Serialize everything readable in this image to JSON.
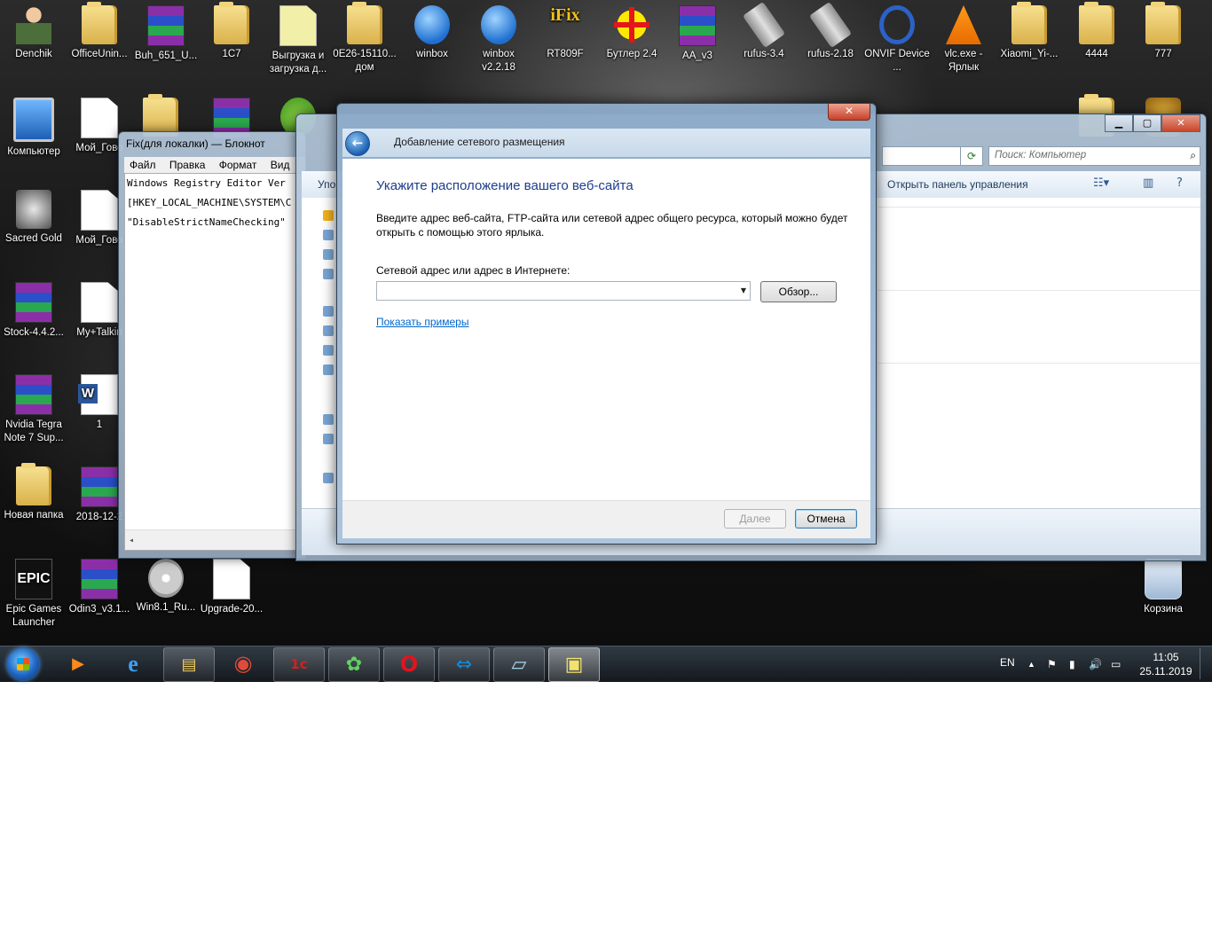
{
  "desktop": {
    "icons": [
      {
        "label": "Denchik",
        "icon": "user-folder-icon"
      },
      {
        "label": "OfficeUnin...",
        "icon": "folder-icon"
      },
      {
        "label": "Buh_651_U...",
        "icon": "winrar-icon"
      },
      {
        "label": "1C7",
        "icon": "folder-icon"
      },
      {
        "label": "Выгрузка и загрузка д...",
        "icon": "file-icon"
      },
      {
        "label": "0E26-15110... дом",
        "icon": "folder-icon"
      },
      {
        "label": "winbox",
        "icon": "winbox-icon"
      },
      {
        "label": "winbox v2.2.18",
        "icon": "winbox-icon"
      },
      {
        "label": "RT809F",
        "icon": "ifix-icon"
      },
      {
        "label": "Бутлер 2.4",
        "icon": "cross-icon"
      },
      {
        "label": "AA_v3",
        "icon": "winrar-icon"
      },
      {
        "label": "rufus-3.4",
        "icon": "usb-icon"
      },
      {
        "label": "rufus-2.18",
        "icon": "usb-icon"
      },
      {
        "label": "ONVIF Device ...",
        "icon": "onvif-icon"
      },
      {
        "label": "vlc.exe - Ярлык",
        "icon": "vlc-icon"
      },
      {
        "label": "Xiaomi_Yi-...",
        "icon": "folder-icon"
      },
      {
        "label": "4444",
        "icon": "folder-icon"
      },
      {
        "label": "777",
        "icon": "folder-icon"
      },
      {
        "label": "Компьютер",
        "icon": "computer-icon"
      },
      {
        "label": "Мой_Гово",
        "icon": "file-icon"
      },
      {
        "label": "Sacred Gold",
        "icon": "game-icon"
      },
      {
        "label": "Мой_Гово",
        "icon": "file-icon"
      },
      {
        "label": "Stock-4.4.2...",
        "icon": "winrar-icon"
      },
      {
        "label": "My+Talkin",
        "icon": "file-icon"
      },
      {
        "label": "Nvidia Tegra Note 7 Sup...",
        "icon": "winrar-icon"
      },
      {
        "label": "1",
        "icon": "word-icon"
      },
      {
        "label": "Новая папка",
        "icon": "folder-icon"
      },
      {
        "label": "2018-12-2",
        "icon": "winrar-icon"
      },
      {
        "label": "Epic Games Launcher",
        "icon": "epic-games-icon"
      },
      {
        "label": "Odin3_v3.1...",
        "icon": "winrar-icon"
      },
      {
        "label": "Win8.1_Ru...",
        "icon": "disc-image-icon"
      },
      {
        "label": "Upgrade-20...",
        "icon": "text-file-icon"
      },
      {
        "label": "Корзина",
        "icon": "recycle-bin-icon"
      }
    ],
    "epic_logo_text": "EPIC",
    "ifix_logo_text": "iFix"
  },
  "notepad": {
    "title": "Fix(для локалки) — Блокнот",
    "menu": [
      "Файл",
      "Правка",
      "Формат",
      "Вид"
    ],
    "lines": [
      "Windows Registry Editor Ver",
      "[HKEY_LOCAL_MACHINE\\SYSTEM\\C",
      "\"DisableStrictNameChecking\""
    ],
    "scroll_left_arrow": "◂"
  },
  "explorer": {
    "caption": {
      "minimize": "▁",
      "maximize": "▢",
      "close": "✕"
    },
    "search_placeholder": "Поиск: Компьютер",
    "toolbar_organize": "Упо",
    "toolbar_control_panel": "Открыть панель управления"
  },
  "dialog": {
    "title": "Добавление сетевого размещения",
    "close_glyph": "✕",
    "back_glyph": "←",
    "heading": "Укажите расположение вашего веб-сайта",
    "description": "Введите адрес веб-сайта, FTP-сайта или сетевой адрес общего ресурса, который можно будет открыть с помощью этого ярлыка.",
    "address_label": "Сетевой адрес или адрес в Интернете:",
    "address_value": "",
    "browse_button": "Обзор...",
    "examples_link": "Показать примеры",
    "next_button": "Далее",
    "cancel_button": "Отмена"
  },
  "taskbar": {
    "items": [
      {
        "name": "media-player-icon",
        "glyph": "▶"
      },
      {
        "name": "internet-explorer-icon",
        "glyph": "e"
      },
      {
        "name": "file-explorer-icon",
        "glyph": "▤"
      },
      {
        "name": "chrome-icon",
        "glyph": "◉"
      },
      {
        "name": "1c-icon",
        "glyph": "1с"
      },
      {
        "name": "icq-icon",
        "glyph": "✿"
      },
      {
        "name": "opera-icon",
        "glyph": "O"
      },
      {
        "name": "teamviewer-icon",
        "glyph": "⇔"
      },
      {
        "name": "notepad-icon",
        "glyph": "▱"
      },
      {
        "name": "network-location-icon",
        "glyph": "▣"
      }
    ],
    "language": "EN",
    "tray_glyphs": [
      "▲",
      "⚑",
      "▮",
      "🔊",
      "▭"
    ],
    "time": "11:05",
    "date": "25.11.2019"
  }
}
